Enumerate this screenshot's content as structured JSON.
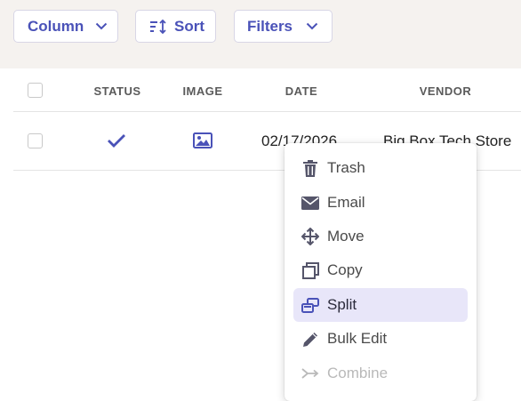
{
  "toolbar": {
    "column_label": "Column",
    "sort_label": "Sort",
    "filters_label": "Filters"
  },
  "table": {
    "headers": [
      "STATUS",
      "IMAGE",
      "DATE",
      "VENDOR"
    ],
    "rows": [
      {
        "status_icon": "check-icon",
        "image_icon": "image-icon",
        "date": "02/17/2026",
        "vendor": "Big Box Tech Store"
      }
    ]
  },
  "context_menu": {
    "items": [
      {
        "label": "Trash",
        "icon": "trash-icon",
        "state": "normal"
      },
      {
        "label": "Email",
        "icon": "envelope-icon",
        "state": "normal"
      },
      {
        "label": "Move",
        "icon": "move-arrows-icon",
        "state": "normal"
      },
      {
        "label": "Copy",
        "icon": "copy-icon",
        "state": "normal"
      },
      {
        "label": "Split",
        "icon": "split-icon",
        "state": "highlighted"
      },
      {
        "label": "Bulk Edit",
        "icon": "pencil-icon",
        "state": "normal"
      },
      {
        "label": "Combine",
        "icon": "combine-icon",
        "state": "disabled"
      }
    ]
  },
  "colors": {
    "accent": "#4a52b8",
    "toolbar_bg": "#f5f2ef",
    "menu_highlight": "#e8e6f9",
    "disabled_text": "#b9b9b9"
  }
}
